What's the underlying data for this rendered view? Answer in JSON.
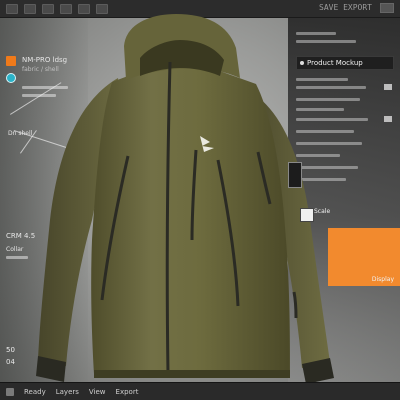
{
  "topbar": {
    "title": "SAVE EXPORT",
    "buttons": [
      "btn1",
      "btn2",
      "btn3",
      "btn4",
      "btn5",
      "btn6"
    ]
  },
  "left_panel": {
    "label_main": "NM-PRO  ldsg",
    "label_sub": "fabric / shell",
    "annotation_1": "Dn shell",
    "annotation_2": "CRM 4.5",
    "annotation_3": "Collar",
    "bottom_value": "50",
    "bottom_value_2": "04"
  },
  "right_panel": {
    "header_label": "Product Mockup",
    "chip_label": "Scale",
    "bottom_label": "Display"
  },
  "bottombar": {
    "items": [
      "Ready",
      "Layers",
      "View",
      "Export"
    ]
  },
  "colors": {
    "jacket": "#6d6b3e",
    "jacket_shadow": "#4f4d2b",
    "jacket_highlight": "#878553",
    "zipper": "#2b2b24",
    "accent_orange": "#f28a2e",
    "accent_teal": "#2bb3c8"
  }
}
